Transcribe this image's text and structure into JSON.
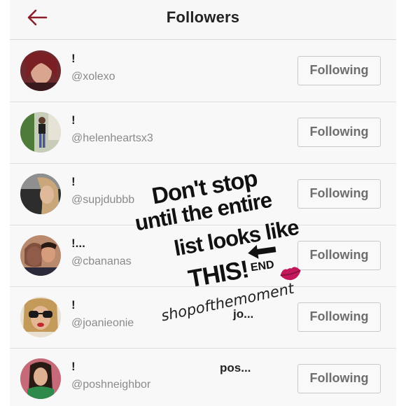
{
  "header": {
    "title": "Followers",
    "back_icon": "arrow-left-icon",
    "accent": "#8b1e2d"
  },
  "follow_label": "Following",
  "followers": [
    {
      "name": "!",
      "handle": "@xolexo",
      "extra": ""
    },
    {
      "name": "!",
      "handle": "@helenheartsx3",
      "extra": ""
    },
    {
      "name": "!",
      "handle": "@supjdubbb",
      "extra": ""
    },
    {
      "name": "!...",
      "handle": "@cbananas",
      "extra": ""
    },
    {
      "name": "!",
      "handle": "@joanieonie",
      "extra": "jo..."
    },
    {
      "name": "!",
      "handle": "@poshneighbor",
      "extra": "pos..."
    }
  ],
  "overlay": {
    "lines": [
      "Don't stop",
      "until the entire",
      "list looks like",
      "THIS!"
    ],
    "end_label": "END",
    "signature": "shopofthemoment",
    "arrow_icon": "arrow-left-icon",
    "lips_icon": "lips-icon"
  }
}
